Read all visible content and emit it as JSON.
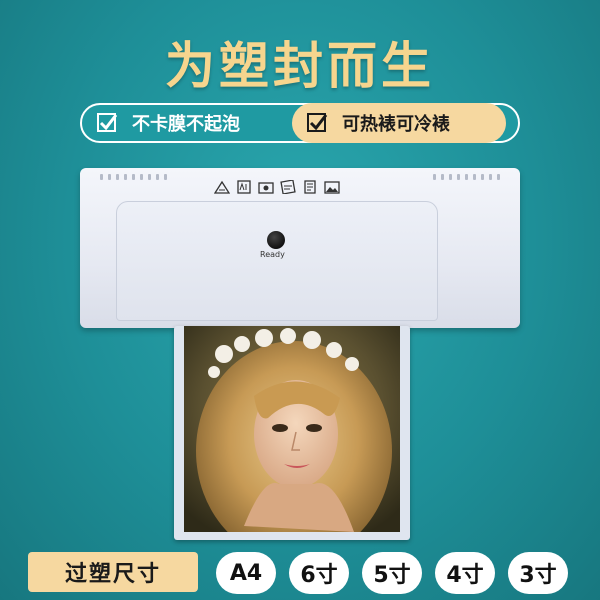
{
  "headline": "为塑封而生",
  "features": [
    {
      "label": "不卡膜不起泡",
      "icon": "check-icon"
    },
    {
      "label": "可热裱可冷裱",
      "icon": "check-icon"
    }
  ],
  "device": {
    "ready_label": "Ready",
    "panel_icons": [
      "laminate-pouch-icon",
      "a4-icon",
      "photo-icon",
      "card-icon",
      "document-icon",
      "image-icon"
    ]
  },
  "sizes": {
    "label": "过塑尺寸",
    "options": [
      "A4",
      "6寸",
      "5寸",
      "4寸",
      "3寸"
    ]
  },
  "colors": {
    "background": "#1e8f98",
    "gold": "#f6d58e",
    "highlight": "#f6d8a0"
  }
}
